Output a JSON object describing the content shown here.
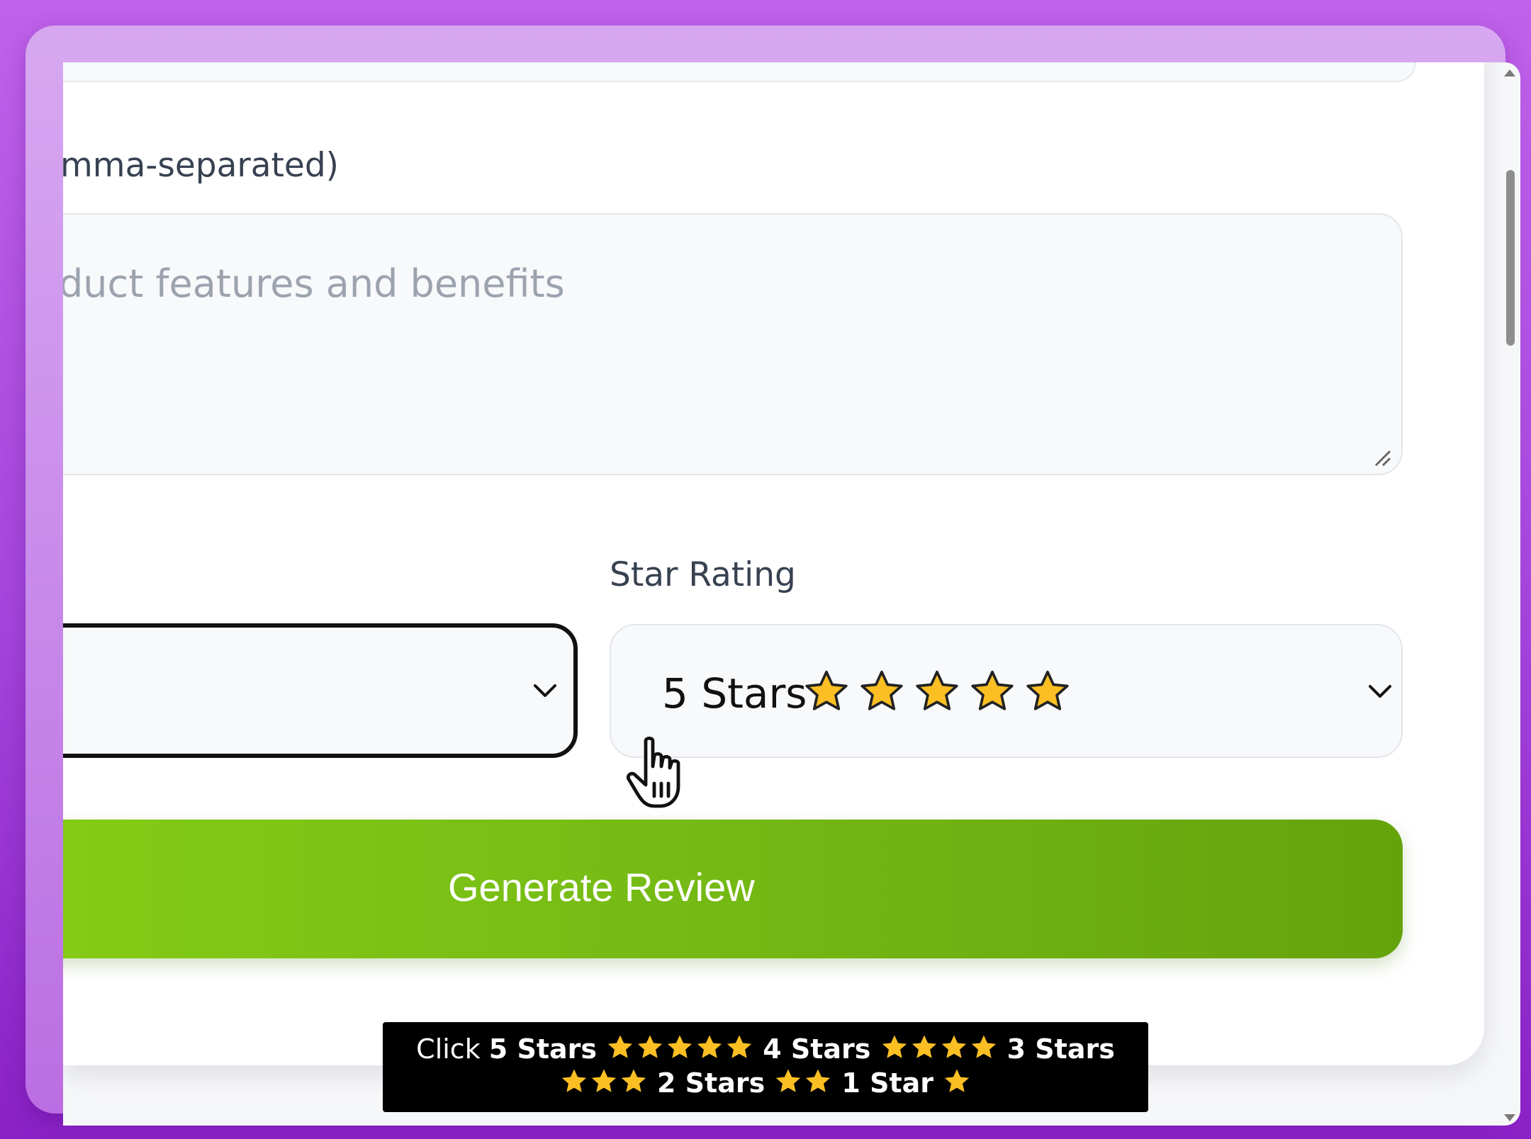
{
  "form": {
    "features_label": "mma-separated)",
    "features_placeholder": "duct features and benefits",
    "left_select_value": "",
    "star_rating_label": "Star Rating",
    "star_rating_value": "5 Stars",
    "star_rating_star_count": 5,
    "generate_button_label": "Generate Review"
  },
  "caption": {
    "click": "Click",
    "opt5": "5 Stars",
    "opt4": "4 Stars",
    "opt3": "3 Stars",
    "opt2": "2 Stars",
    "opt1": "1 Star"
  },
  "colors": {
    "background_top": "#c062ea",
    "background_bottom": "#8a21c6",
    "button_start": "#84cc16",
    "button_end": "#65a30d",
    "star_fill": "#fbbf24"
  },
  "icons": {
    "star": "star-icon",
    "select_arrow": "chevron-down-icon",
    "resize": "resize-handle-icon",
    "cursor": "hand-pointer-icon"
  }
}
